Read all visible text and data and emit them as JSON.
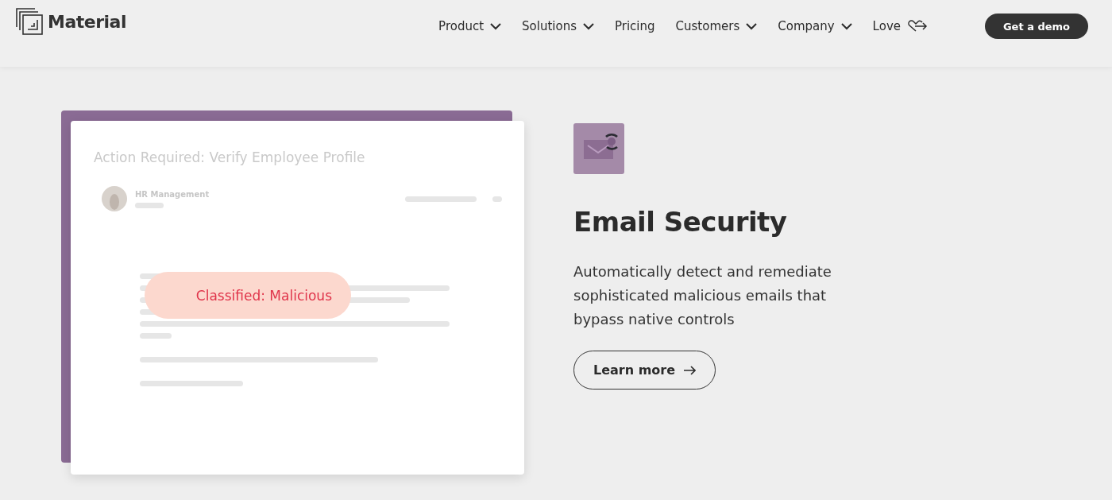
{
  "header": {
    "logo": "Material",
    "nav": [
      {
        "label": "Product",
        "kind": "dropdown"
      },
      {
        "label": "Solutions",
        "kind": "dropdown"
      },
      {
        "label": "Pricing",
        "kind": "link"
      },
      {
        "label": "Customers",
        "kind": "dropdown"
      },
      {
        "label": "Company",
        "kind": "dropdown"
      },
      {
        "label": "Love",
        "kind": "heart"
      }
    ],
    "cta": "Get a demo"
  },
  "preview": {
    "email_subject": "Action Required: Verify Employee Profile",
    "sender": "HR Management",
    "badge": "Classified: Malicious"
  },
  "feature": {
    "title": "Email Security",
    "description": "Automatically detect and remediate sophisticated malicious emails that bypass native controls",
    "button": "Learn more"
  }
}
